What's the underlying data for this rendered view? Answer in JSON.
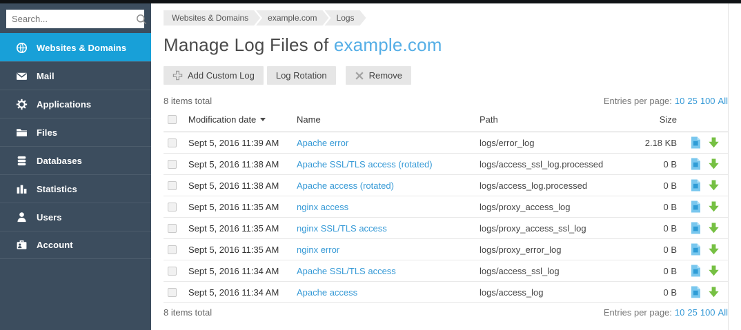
{
  "sidebar": {
    "search": {
      "placeholder": "Search..."
    },
    "items": [
      {
        "label": "Websites & Domains",
        "icon": "globe-icon",
        "active": true
      },
      {
        "label": "Mail",
        "icon": "mail-icon",
        "active": false
      },
      {
        "label": "Applications",
        "icon": "gear-icon",
        "active": false
      },
      {
        "label": "Files",
        "icon": "folder-icon",
        "active": false
      },
      {
        "label": "Databases",
        "icon": "database-icon",
        "active": false
      },
      {
        "label": "Statistics",
        "icon": "bar-chart-icon",
        "active": false
      },
      {
        "label": "Users",
        "icon": "user-icon",
        "active": false
      },
      {
        "label": "Account",
        "icon": "badge-icon",
        "active": false
      }
    ]
  },
  "breadcrumb": [
    "Websites & Domains",
    "example.com",
    "Logs"
  ],
  "page": {
    "title_prefix": "Manage Log Files of ",
    "title_domain": "example.com"
  },
  "toolbar": {
    "add_custom_log": "Add Custom Log",
    "log_rotation": "Log Rotation",
    "remove": "Remove"
  },
  "list": {
    "items_total": "8 items total",
    "entries_per_page_label": "Entries per page:",
    "page_size_options": [
      "10",
      "25",
      "100",
      "All"
    ]
  },
  "table": {
    "headers": {
      "modification_date": "Modification date",
      "name": "Name",
      "path": "Path",
      "size": "Size"
    },
    "rows": [
      {
        "date": "Sept 5, 2016 11:39 AM",
        "name": "Apache error",
        "path": "logs/error_log",
        "size": "2.18 KB"
      },
      {
        "date": "Sept 5, 2016 11:38 AM",
        "name": "Apache SSL/TLS access (rotated)",
        "path": "logs/access_ssl_log.processed",
        "size": "0 B"
      },
      {
        "date": "Sept 5, 2016 11:38 AM",
        "name": "Apache access (rotated)",
        "path": "logs/access_log.processed",
        "size": "0 B"
      },
      {
        "date": "Sept 5, 2016 11:35 AM",
        "name": "nginx access",
        "path": "logs/proxy_access_log",
        "size": "0 B"
      },
      {
        "date": "Sept 5, 2016 11:35 AM",
        "name": "nginx SSL/TLS access",
        "path": "logs/proxy_access_ssl_log",
        "size": "0 B"
      },
      {
        "date": "Sept 5, 2016 11:35 AM",
        "name": "nginx error",
        "path": "logs/proxy_error_log",
        "size": "0 B"
      },
      {
        "date": "Sept 5, 2016 11:34 AM",
        "name": "Apache SSL/TLS access",
        "path": "logs/access_ssl_log",
        "size": "0 B"
      },
      {
        "date": "Sept 5, 2016 11:34 AM",
        "name": "Apache access",
        "path": "logs/access_log",
        "size": "0 B"
      }
    ],
    "row_icons": [
      "view-log-file-icon",
      "download-log-icon"
    ]
  },
  "colors": {
    "sidebar_bg": "#3c4d5e",
    "sidebar_active_bg": "#18a0d8",
    "link_blue": "#3599d6",
    "title_link_blue": "#55aee6",
    "download_green": "#76c043",
    "file_icon_blue": "#79c7ee",
    "topbar_black": "#101316"
  }
}
